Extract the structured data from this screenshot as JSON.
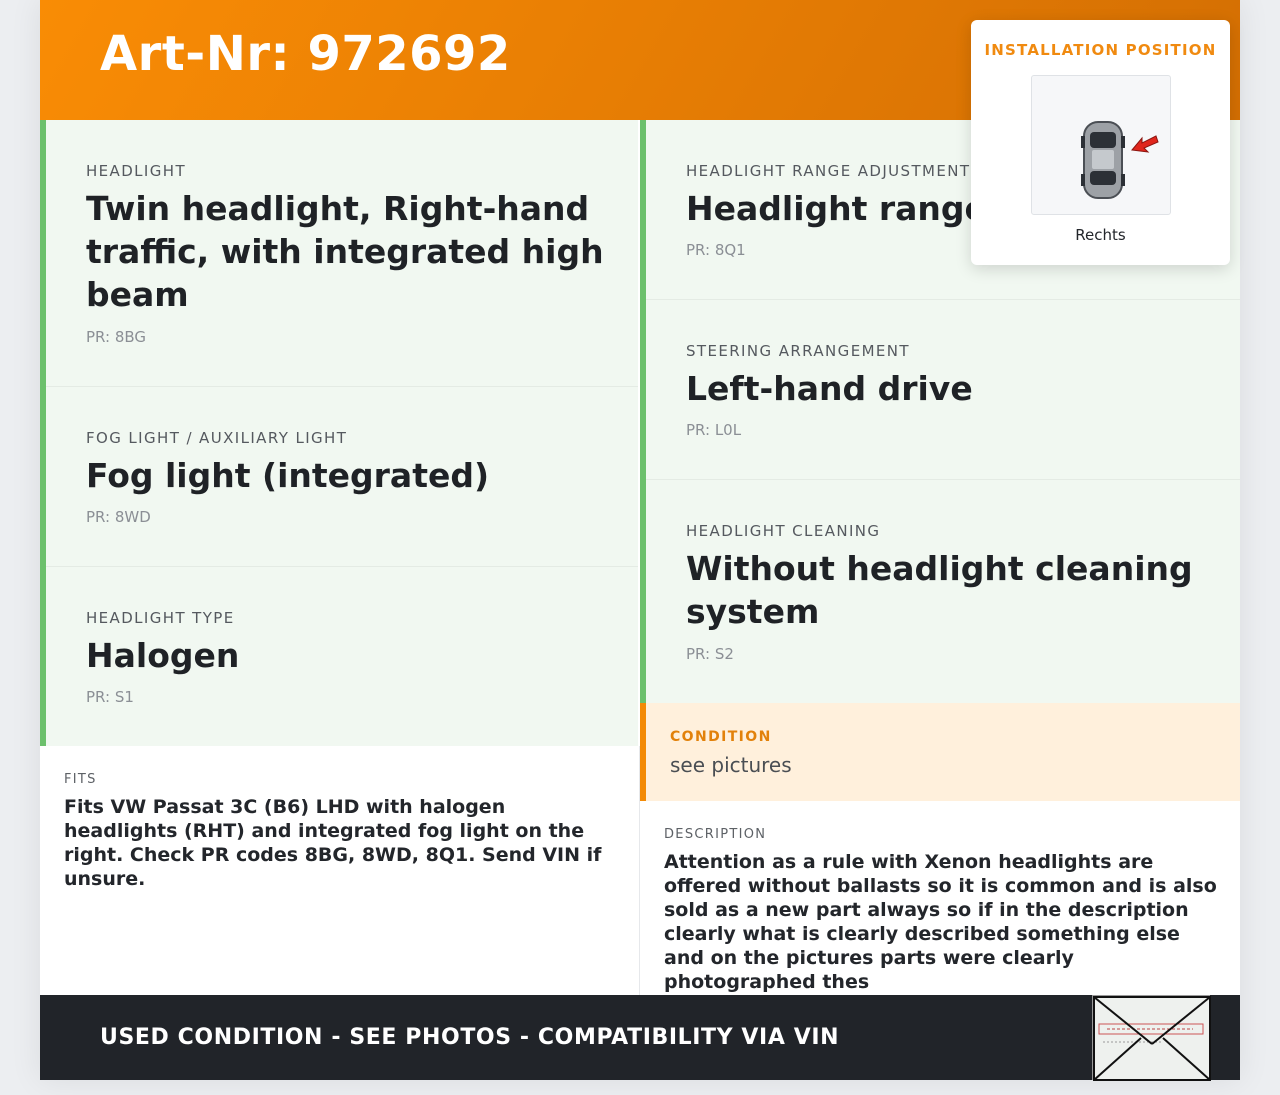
{
  "header": {
    "title": "Art-Nr: 972692"
  },
  "left_panels": [
    {
      "label": "HEADLIGHT",
      "value": "Twin headlight, Right-hand traffic, with integrated high beam",
      "pr": "PR: 8BG"
    },
    {
      "label": "FOG LIGHT / AUXILIARY LIGHT",
      "value": "Fog light (integrated)",
      "pr": "PR: 8WD"
    },
    {
      "label": "HEADLIGHT TYPE",
      "value": "Halogen",
      "pr": "PR: S1"
    }
  ],
  "right_panels": [
    {
      "label": "HEADLIGHT RANGE ADJUSTMENT",
      "value": "Headlight range",
      "pr": "PR: 8Q1"
    },
    {
      "label": "STEERING ARRANGEMENT",
      "value": "Left-hand drive",
      "pr": "PR: L0L"
    },
    {
      "label": "HEADLIGHT CLEANING",
      "value": "Without headlight cleaning system",
      "pr": "PR: S2"
    }
  ],
  "condition": {
    "label": "CONDITION",
    "value": "see pictures"
  },
  "fits": {
    "label": "FITS",
    "text": "Fits VW Passat 3C (B6) LHD with halogen headlights (RHT) and integrated fog light on the right. Check PR codes 8BG, 8WD, 8Q1. Send VIN if unsure."
  },
  "description": {
    "label": "DESCRIPTION",
    "text": "Attention as a rule with Xenon headlights are offered without ballasts so it is common and is also sold as a new part always so if in the description clearly what is clearly described something else and on the pictures parts were clearly photographed thes"
  },
  "footer": {
    "text": "USED CONDITION - SEE PHOTOS - COMPATIBILITY VIA VIN"
  },
  "install_position": {
    "title": "INSTALLATION POSITION",
    "position": "Rechts",
    "icon": "car-top-view-arrow-icon"
  },
  "colors": {
    "accent": "#f38a06",
    "panel_bg": "#f1f8f1",
    "panel_border": "#6cc06c",
    "footer_bg": "#212429"
  }
}
